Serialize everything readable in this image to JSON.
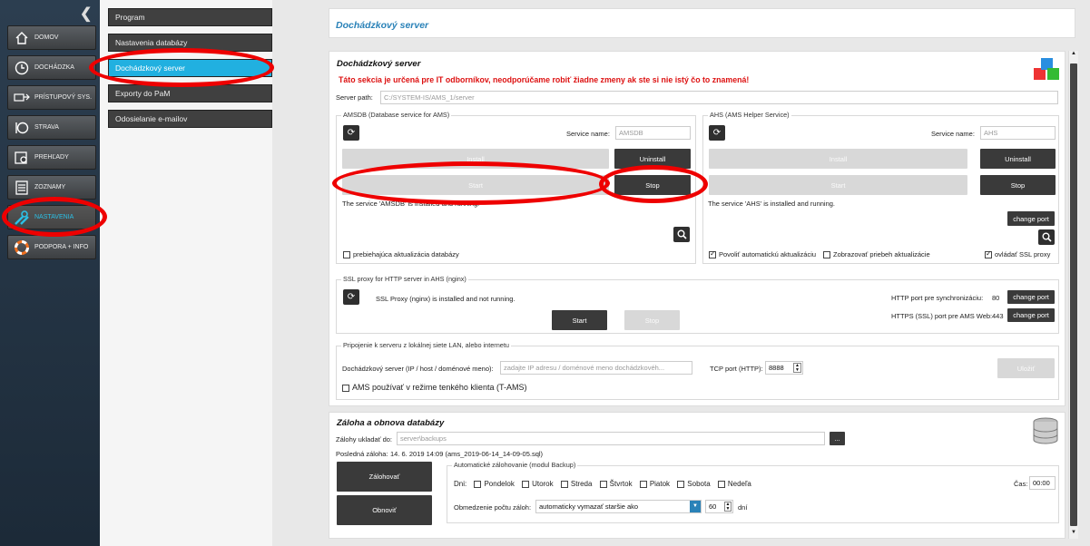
{
  "nav": {
    "collapse_icon": "chevron-left-icon",
    "items": [
      {
        "label": "DOMOV",
        "icon": "home-icon"
      },
      {
        "label": "DOCHÁDZKA",
        "icon": "clock-icon"
      },
      {
        "label": "PRÍSTUPOVÝ SYS.",
        "icon": "access-icon"
      },
      {
        "label": "STRAVA",
        "icon": "meal-icon"
      },
      {
        "label": "PREHĽADY",
        "icon": "reports-icon"
      },
      {
        "label": "ZOZNAMY",
        "icon": "list-icon"
      },
      {
        "label": "NASTAVENIA",
        "icon": "tools-icon"
      },
      {
        "label": "PODPORA + INFO",
        "icon": "lifebuoy-icon"
      }
    ],
    "active_index": 6,
    "active_color": "#2cc0e6"
  },
  "submenu": {
    "items": [
      "Program",
      "Nastavenia databázy",
      "Dochádzkový server",
      "Exporty do PaM",
      "Odosielanie e-mailov"
    ],
    "active_index": 2,
    "active_color": "#21b0e0"
  },
  "header": {
    "title": "Dochádzkový server"
  },
  "server": {
    "title": "Dochádzkový server",
    "warning": "Táto sekcia je určená pre IT odborníkov, neodporúčame robiť žiadne zmeny ak ste si nie istý čo to znamená!",
    "path_label": "Server path:",
    "path_value": "C:/SYSTEM-IS/AMS_1/server",
    "amsdb": {
      "legend": "AMSDB (Database service for AMS)",
      "service_name_label": "Service name:",
      "service_name_value": "AMSDB",
      "install": "Install",
      "uninstall": "Uninstall",
      "start": "Start",
      "stop": "Stop",
      "status": "The service 'AMSDB' is installed and running.",
      "checkbox_update": "prebiehajúca aktualizácia databázy"
    },
    "ahs": {
      "legend": "AHS (AMS Helper Service)",
      "service_name_label": "Service name:",
      "service_name_value": "AHS",
      "install": "Install",
      "uninstall": "Uninstall",
      "start": "Start",
      "stop": "Stop",
      "status": "The service 'AHS' is installed and running.",
      "change_port": "change port",
      "cb_auto_update": "Povoliť automatickú aktualizáciu",
      "cb_show_progress": "Zobrazovať priebeh aktualizácie",
      "cb_ssl_proxy": "ovládať SSL proxy"
    },
    "ssl": {
      "legend": "SSL proxy for HTTP server in AHS (nginx)",
      "status": "SSL Proxy (nginx) is installed and not running.",
      "start": "Start",
      "stop": "Stop",
      "http_label": "HTTP port pre synchronizáciu:",
      "http_port": "80",
      "https_label": "HTTPS (SSL) port pre AMS Web:",
      "https_port": "443",
      "change_port": "change port"
    },
    "lan": {
      "legend": "Pripojenie k serveru z lokálnej siete LAN, alebo internetu",
      "server_label": "Dochádzkový server (IP / host / doménové meno):",
      "server_placeholder": "zadajte IP adresu / doménové meno dochádzkovéh...",
      "tcp_label": "TCP port (HTTP):",
      "tcp_value": "8888",
      "save": "Uložiť",
      "thin_client": "AMS používať v režime tenkého klienta (T-AMS)"
    }
  },
  "backup": {
    "title": "Záloha a obnova databázy",
    "save_to_label": "Zálohy ukladať do:",
    "save_to_value": "server\\backups",
    "browse": "...",
    "last_backup_label": "Posledná záloha:",
    "last_backup_value": "14. 6. 2019 14:09 (ams_2019-06-14_14-09-05.sql)",
    "backup_button": "Zálohovať",
    "restore_button": "Obnoviť",
    "auto_legend": "Automatické zálohovanie (modul Backup)",
    "days_label": "Dni:",
    "days": [
      "Pondelok",
      "Utorok",
      "Streda",
      "Štvrtok",
      "Piatok",
      "Sobota",
      "Nedeľa"
    ],
    "time_label": "Čas:",
    "time_value": "00:00",
    "limit_label": "Obmedzenie počtu záloh:",
    "limit_option": "automaticky vymazať staršie ako",
    "limit_value": "60",
    "limit_unit": "dní"
  },
  "colors": {
    "accent": "#2a82b8",
    "warning": "#dd1111",
    "annotation": "#ee0000"
  }
}
